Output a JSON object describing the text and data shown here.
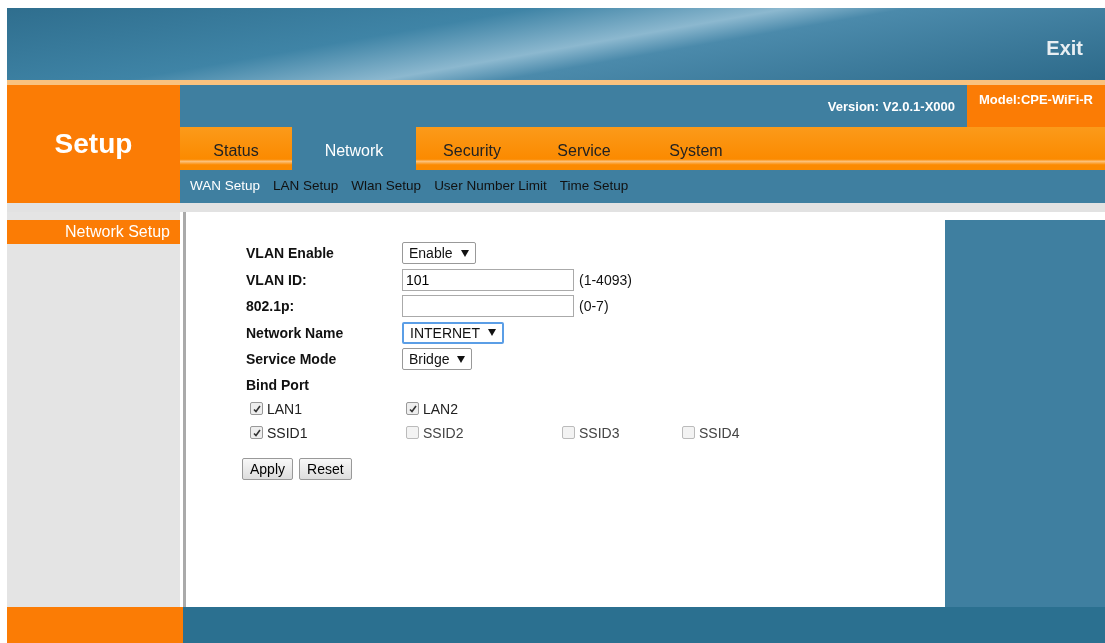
{
  "header": {
    "exit": "Exit"
  },
  "side_title": "Setup",
  "version": "Version: V2.0.1-X000",
  "model": "Model:CPE-WiFi-R",
  "tabs": [
    {
      "label": "Status",
      "selected": false
    },
    {
      "label": "Network",
      "selected": true
    },
    {
      "label": "Security",
      "selected": false
    },
    {
      "label": "Service",
      "selected": false
    },
    {
      "label": "System",
      "selected": false
    }
  ],
  "subtabs": [
    {
      "label": "WAN Setup",
      "selected": true
    },
    {
      "label": "LAN Setup",
      "selected": false
    },
    {
      "label": "Wlan Setup",
      "selected": false
    },
    {
      "label": "User Number Limit",
      "selected": false
    },
    {
      "label": "Time Setup",
      "selected": false
    }
  ],
  "sidebar": {
    "items": [
      {
        "label": "Network Setup",
        "selected": true
      }
    ]
  },
  "form": {
    "fields": [
      {
        "kind": "select",
        "label": "VLAN Enable",
        "value": "Enable",
        "focused": false
      },
      {
        "kind": "text",
        "label": "VLAN ID:",
        "value": "101",
        "hint": "(1-4093)"
      },
      {
        "kind": "text",
        "label": "802.1p:",
        "hint": "(0-7)"
      },
      {
        "kind": "select",
        "label": "Network Name",
        "value": "INTERNET",
        "focused": true
      },
      {
        "kind": "select",
        "label": "Service Mode",
        "value": "Bridge",
        "focused": false
      }
    ],
    "bind_port": {
      "label": "Bind Port",
      "rows": [
        [
          {
            "label": "LAN1",
            "checked": true
          },
          {
            "label": "LAN2",
            "checked": true
          }
        ],
        [
          {
            "label": "SSID1",
            "checked": true
          },
          {
            "label": "SSID2",
            "checked": false
          },
          {
            "label": "SSID3",
            "checked": false
          },
          {
            "label": "SSID4",
            "checked": false
          }
        ]
      ]
    },
    "buttons": [
      "Apply",
      "Reset"
    ]
  }
}
